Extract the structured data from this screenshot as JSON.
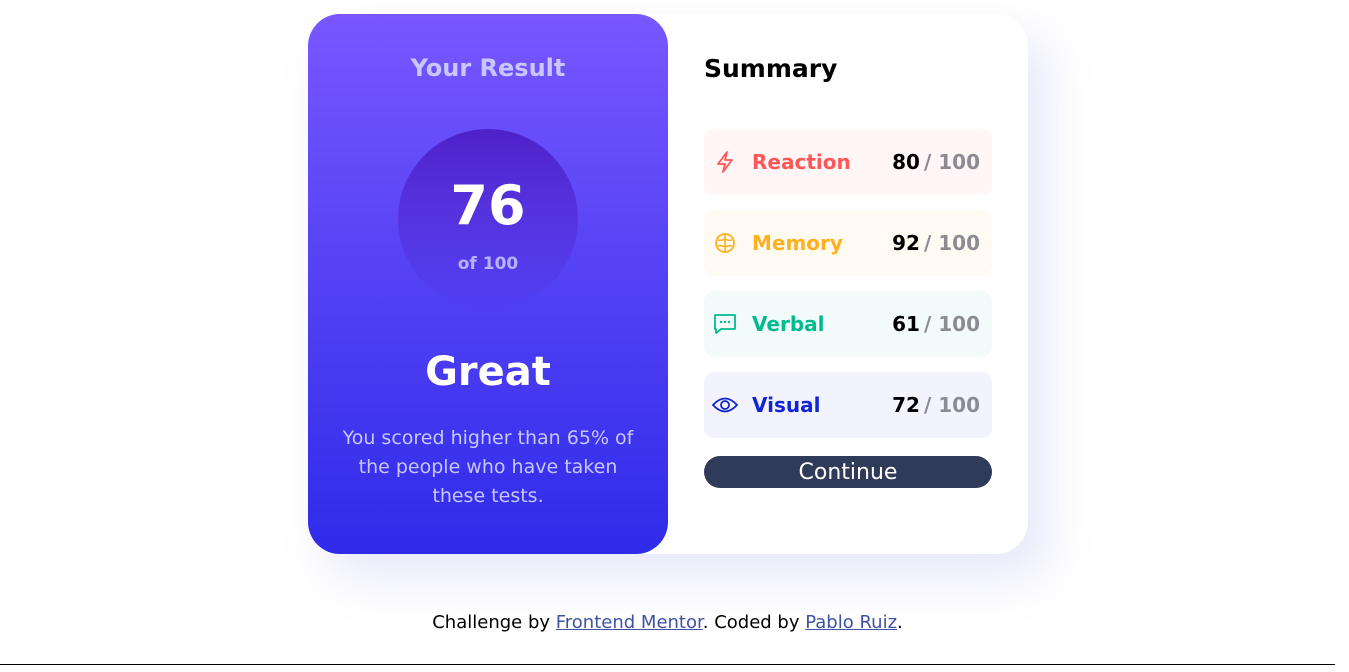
{
  "result": {
    "title": "Your Result",
    "score": "76",
    "score_of": "of 100",
    "rating": "Great",
    "description": "You scored higher than 65% of the people who have taken these tests."
  },
  "summary": {
    "title": "Summary",
    "items": [
      {
        "label": "Reaction",
        "score": "80",
        "total": "/ 100",
        "icon": "lightning-icon",
        "color": "#ff5757",
        "bg": "#fff6f5"
      },
      {
        "label": "Memory",
        "score": "92",
        "total": "/ 100",
        "icon": "brain-icon",
        "color": "#ffb01f",
        "bg": "#fffbf3"
      },
      {
        "label": "Verbal",
        "score": "61",
        "total": "/ 100",
        "icon": "speech-bubble-icon",
        "color": "#00bb8f",
        "bg": "#f2fbf9"
      },
      {
        "label": "Visual",
        "score": "72",
        "total": "/ 100",
        "icon": "eye-icon",
        "color": "#1125d4",
        "bg": "#f3f3fd"
      }
    ],
    "continue_label": "Continue"
  },
  "footer": {
    "prefix": "Challenge by ",
    "link1": "Frontend Mentor",
    "middle": ". Coded by ",
    "link2": "Pablo Ruiz",
    "suffix": "."
  }
}
